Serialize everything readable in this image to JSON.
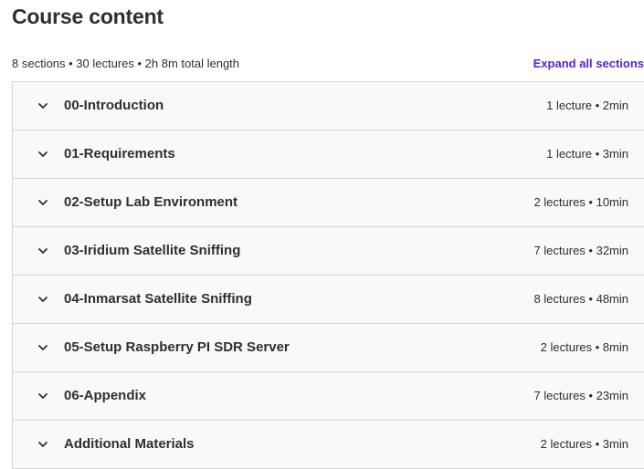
{
  "header": {
    "title": "Course content",
    "summary": "8 sections • 30 lectures • 2h 8m total length",
    "expand_all_label": "Expand all sections"
  },
  "sections": [
    {
      "title": "00-Introduction",
      "meta": "1 lecture • 2min"
    },
    {
      "title": "01-Requirements",
      "meta": "1 lecture • 3min"
    },
    {
      "title": "02-Setup Lab Environment",
      "meta": "2 lectures • 10min"
    },
    {
      "title": "03-Iridium Satellite Sniffing",
      "meta": "7 lectures • 32min"
    },
    {
      "title": "04-Inmarsat Satellite Sniffing",
      "meta": "8 lectures • 48min"
    },
    {
      "title": "05-Setup Raspberry PI SDR Server",
      "meta": "2 lectures • 8min"
    },
    {
      "title": "06-Appendix",
      "meta": "7 lectures • 23min"
    },
    {
      "title": "Additional Materials",
      "meta": "2 lectures • 3min"
    }
  ],
  "icons": {
    "section_toggle": "chevron-down-icon"
  },
  "colors": {
    "text": "#2d2f31",
    "link": "#5624d0",
    "section_bg": "#f7f9fa",
    "border": "#d1d7dc"
  }
}
